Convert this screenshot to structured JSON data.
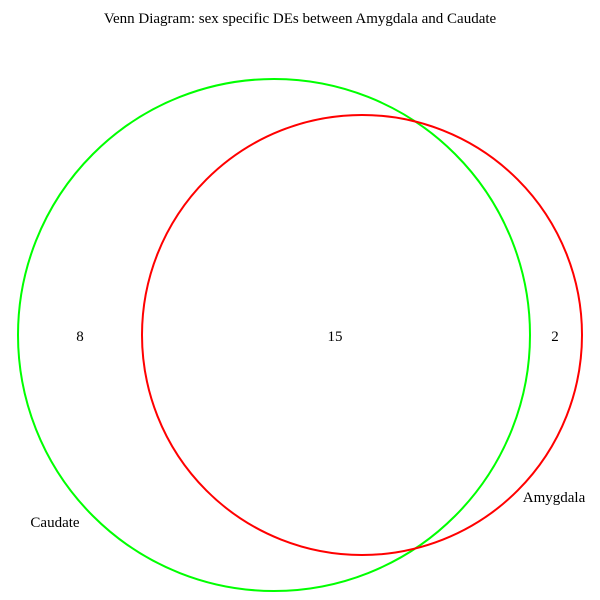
{
  "title": "Venn Diagram: sex specific DEs between Amygdala and Caudate",
  "sets": [
    {
      "name": "Caudate",
      "color": "#00ff00"
    },
    {
      "name": "Amygdala",
      "color": "#ff0000"
    }
  ],
  "regions": {
    "caudate_only": "8",
    "both": "15",
    "amygdala_only": "2"
  }
}
